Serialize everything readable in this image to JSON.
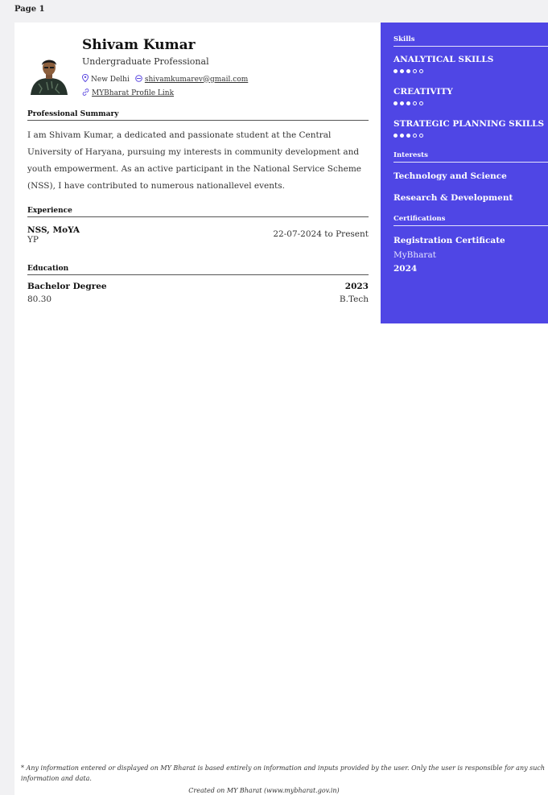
{
  "page_label": "Page 1",
  "profile": {
    "name": "Shivam Kumar",
    "title": "Undergraduate Professional",
    "location": "New Delhi",
    "email": "shivamkumarev@gmail.com",
    "profile_link": "MYBharat Profile Link"
  },
  "summary": {
    "heading": "Professional Summary",
    "text": "I am Shivam Kumar, a dedicated and passionate student at the Central University of Haryana, pursuing my interests in community development and youth empowerment. As an active participant in the National Service Scheme (NSS), I have contributed to numerous nationallevel events."
  },
  "experience": {
    "heading": "Experience",
    "org": "NSS, MoYA",
    "role": "YP",
    "dates": "22-07-2024 to Present"
  },
  "education": {
    "heading": "Education",
    "degree": "Bachelor Degree",
    "year": "2023",
    "score": "80.30",
    "course": "B.Tech"
  },
  "sidebar": {
    "accent": "#4f46e5",
    "skills_heading": "Skills",
    "skills": [
      {
        "name": "ANALYTICAL SKILLS",
        "level": 3,
        "max": 5
      },
      {
        "name": "CREATIVITY",
        "level": 3,
        "max": 5
      },
      {
        "name": "STRATEGIC PLANNING SKILLS",
        "level": 3,
        "max": 5
      }
    ],
    "interests_heading": "Interests",
    "interests": [
      "Technology and Science",
      "Research & Development"
    ],
    "certifications_heading": "Certifications",
    "cert_name": "Registration Certificate",
    "cert_issuer": "MyBharat",
    "cert_year": "2024"
  },
  "footer": {
    "disclaimer": "* Any information entered or displayed on MY Bharat is based entirely on information and inputs provided by the user. Only the user is responsible for any such information and data.",
    "created": "Created on MY Bharat (www.mybharat.gov.in)"
  }
}
